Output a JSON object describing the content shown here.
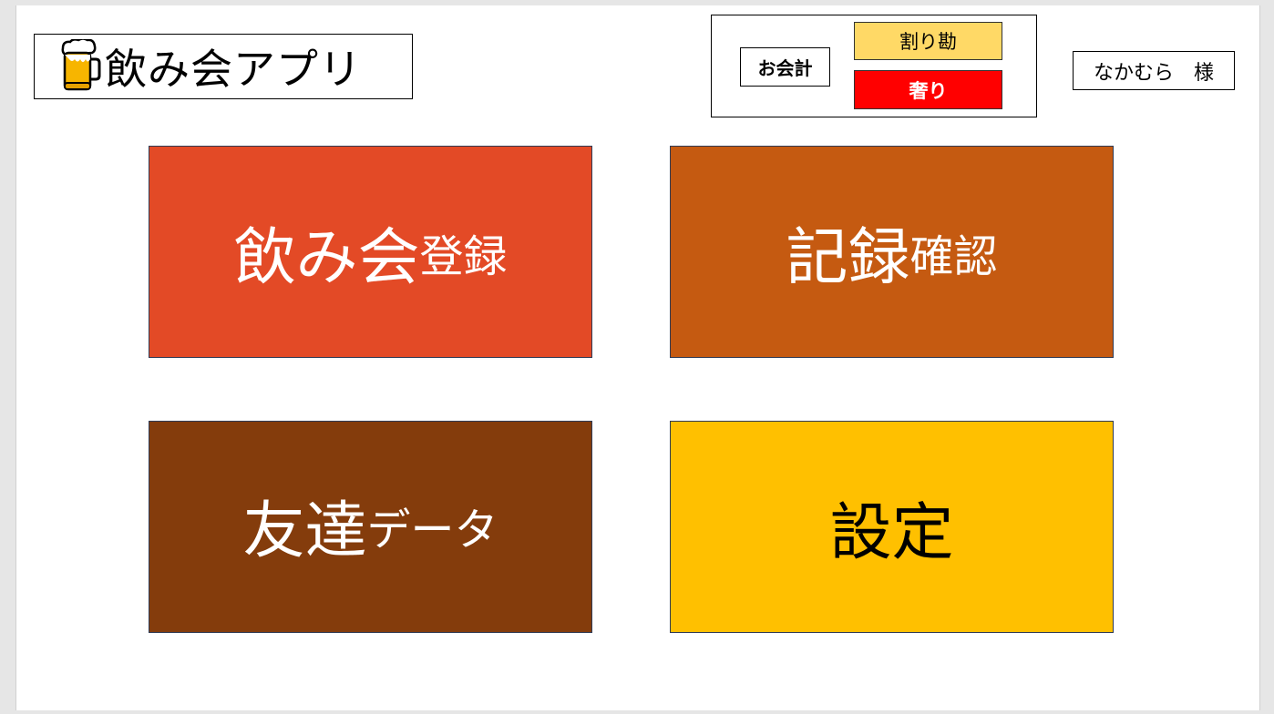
{
  "app": {
    "title": "飲み会アプリ",
    "icon": "beer-mug-icon"
  },
  "payment": {
    "label": "お会計",
    "split_label": "割り勘",
    "treat_label": "奢り",
    "colors": {
      "split": "#ffd966",
      "treat": "#ff0000"
    }
  },
  "user": {
    "display": "なかむら　様"
  },
  "menu": {
    "register": {
      "main": "飲み会",
      "sub": "登録",
      "color": "#e34a26"
    },
    "records": {
      "main": "記録",
      "sub": "確認",
      "color": "#c55a11"
    },
    "friends": {
      "main": "友達",
      "sub": "データ",
      "color": "#843c0c"
    },
    "settings": {
      "main": "設定",
      "color": "#ffc000"
    }
  }
}
